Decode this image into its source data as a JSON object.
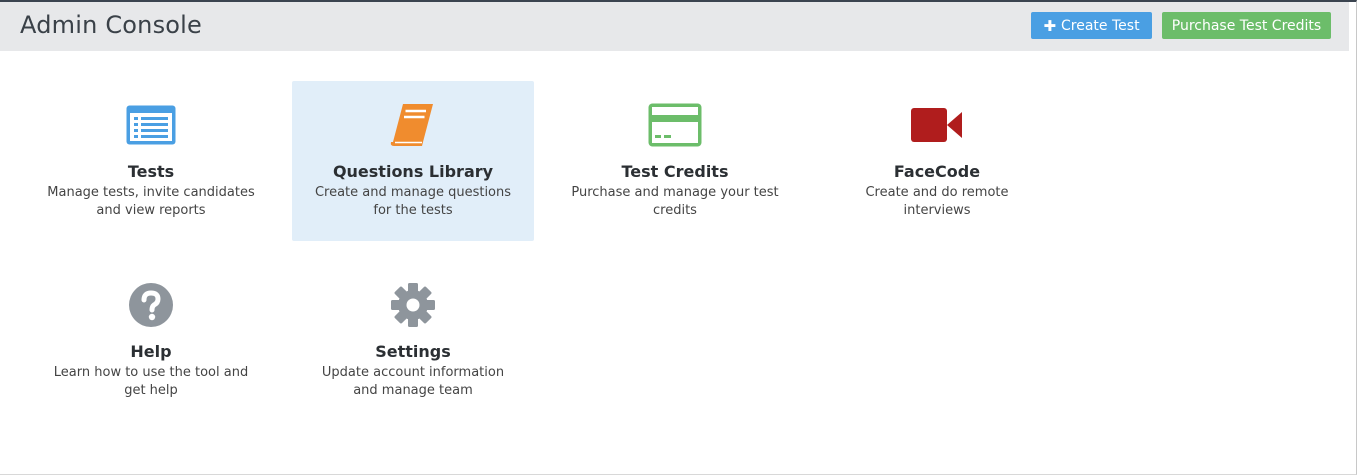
{
  "header": {
    "title": "Admin Console",
    "create_test_label": "Create Test",
    "purchase_credits_label": "Purchase Test Credits"
  },
  "tiles": [
    {
      "title": "Tests",
      "description": "Manage tests, invite candidates and view reports",
      "icon": "list-window-icon",
      "color": "#4a9fe3"
    },
    {
      "title": "Questions Library",
      "description": "Create and manage questions for the tests",
      "icon": "book-icon",
      "color": "#f08c2e"
    },
    {
      "title": "Test Credits",
      "description": "Purchase and manage your test credits",
      "icon": "credit-card-icon",
      "color": "#6cbd6a"
    },
    {
      "title": "FaceCode",
      "description": "Create and do remote interviews",
      "icon": "video-camera-icon",
      "color": "#b01d1d"
    },
    {
      "title": "Help",
      "description": "Learn how to use the tool and get help",
      "icon": "question-circle-icon",
      "color": "#8e959c"
    },
    {
      "title": "Settings",
      "description": "Update account information and manage team",
      "icon": "gear-icon",
      "color": "#8e959c"
    }
  ],
  "colors": {
    "header_bg": "#e7e8ea",
    "primary_button": "#4a9fe3",
    "success_button": "#6cbd6a",
    "active_tile_bg": "#e1eef9"
  }
}
